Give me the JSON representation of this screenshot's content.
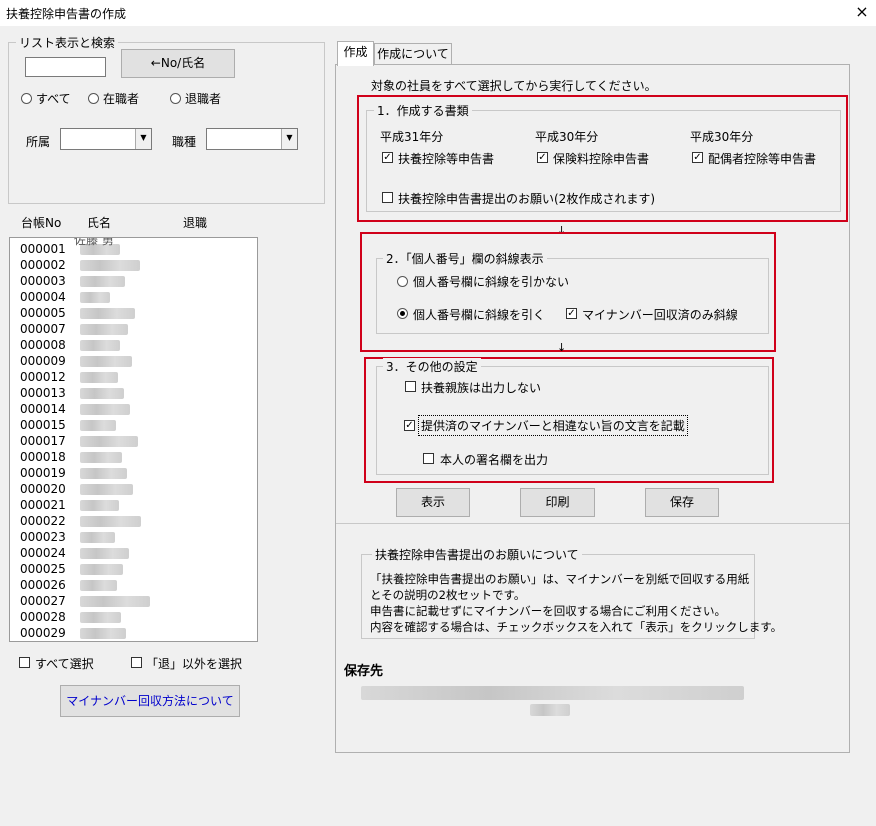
{
  "window": {
    "title": "扶養控除申告書の作成",
    "close_glyph": "×"
  },
  "search": {
    "legend": "リスト表示と検索",
    "input_value": "",
    "toggle_button": "←No/氏名",
    "radio_all": "すべて",
    "radio_active": "在職者",
    "radio_retired": "退職者",
    "selected_radio": "none",
    "dept_label": "所属",
    "dept_value": "",
    "job_label": "職種",
    "job_value": "",
    "dropdown_glyph": "▼"
  },
  "list": {
    "headers": [
      "台帳No",
      "氏名",
      "退職"
    ],
    "rows": [
      "000001",
      "000002",
      "000003",
      "000004",
      "000005",
      "000007",
      "000008",
      "000009",
      "000012",
      "000013",
      "000014",
      "000015",
      "000017",
      "000018",
      "000019",
      "000020",
      "000021",
      "000022",
      "000023",
      "000024",
      "000025",
      "000026",
      "000027",
      "000028",
      "000029"
    ],
    "partial_name": "佐藤 勇"
  },
  "bottom_left": {
    "select_all": "すべて選択",
    "select_non_retired": "「退」以外を選択",
    "mynumber_button": "マイナンバー回収方法について"
  },
  "tabs": [
    "作成",
    "作成について"
  ],
  "main": {
    "instruction": "対象の社員をすべて選択してから実行してください。",
    "section1": {
      "legend": "1．作成する書類",
      "col_years": [
        "平成31年分",
        "平成30年分",
        "平成30年分"
      ],
      "doc1": "扶養控除等申告書",
      "doc2": "保険料控除申告書",
      "doc3": "配偶者控除等申告書",
      "doc4": "扶養控除申告書提出のお願い(2枚作成されます)"
    },
    "arrow": "↓",
    "section2": {
      "legend": "2．「個人番号」欄の斜線表示",
      "opt_no_line": "個人番号欄に斜線を引かない",
      "opt_line": "個人番号欄に斜線を引く",
      "collected_only": "マイナンバー回収済のみ斜線"
    },
    "section3": {
      "legend": "3．その他の設定",
      "no_dependents": "扶養親族は出力しない",
      "statement": "提供済のマイナンバーと相違ない旨の文言を記載",
      "signature": "本人の署名欄を出力"
    },
    "buttons": {
      "show": "表示",
      "print": "印刷",
      "save": "保存"
    },
    "info": {
      "legend": "扶養控除申告書提出のお願いについて",
      "lines": [
        "「扶養控除申告書提出のお願い」は、マイナンバーを別紙で回収する用紙",
        "とその説明の2枚セットです。",
        "申告書に記載せずにマイナンバーを回収する場合にご利用ください。",
        "内容を確認する場合は、チェックボックスを入れて「表示」をクリックします。"
      ]
    },
    "save_label": "保存先"
  },
  "check_glyph": "✓",
  "colors": {
    "highlight_border": "#d0001a",
    "link_blue": "#0000cc"
  }
}
